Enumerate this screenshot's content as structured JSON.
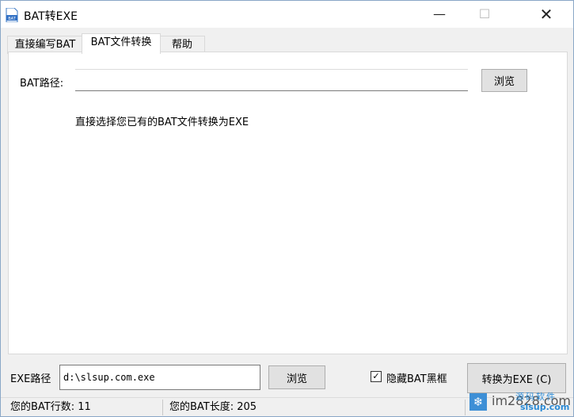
{
  "window": {
    "title": "BAT转EXE",
    "minimize_glyph": "—",
    "maximize_glyph": "☐",
    "close_glyph": "✕"
  },
  "tabs": [
    {
      "label": "直接编写BAT",
      "active": false
    },
    {
      "label": "BAT文件转换",
      "active": true
    },
    {
      "label": "帮助",
      "active": false
    }
  ],
  "bat_panel": {
    "path_label": "BAT路径:",
    "path_value": "",
    "browse_label": "浏览",
    "hint": "直接选择您已有的BAT文件转换为EXE"
  },
  "exe_row": {
    "path_label": "EXE路径",
    "path_value": "d:\\slsup.com.exe",
    "browse_label": "浏览",
    "hide_console_label": "隐藏BAT黑框",
    "hide_console_checked": true,
    "convert_label": "转换为EXE (C)"
  },
  "status": {
    "line_count": "您的BAT行数: 11",
    "length": "您的BAT长度: 205"
  },
  "watermark": {
    "brand": "im2828.com",
    "top": "源码软件",
    "sub": "slsup.com"
  },
  "colors": {
    "accent": "#3d8fd6",
    "button_face": "#e1e1e1",
    "window_bg": "#f0f0f0"
  },
  "icons": {
    "app": "bat-file-icon",
    "checkbox": "check-icon"
  }
}
